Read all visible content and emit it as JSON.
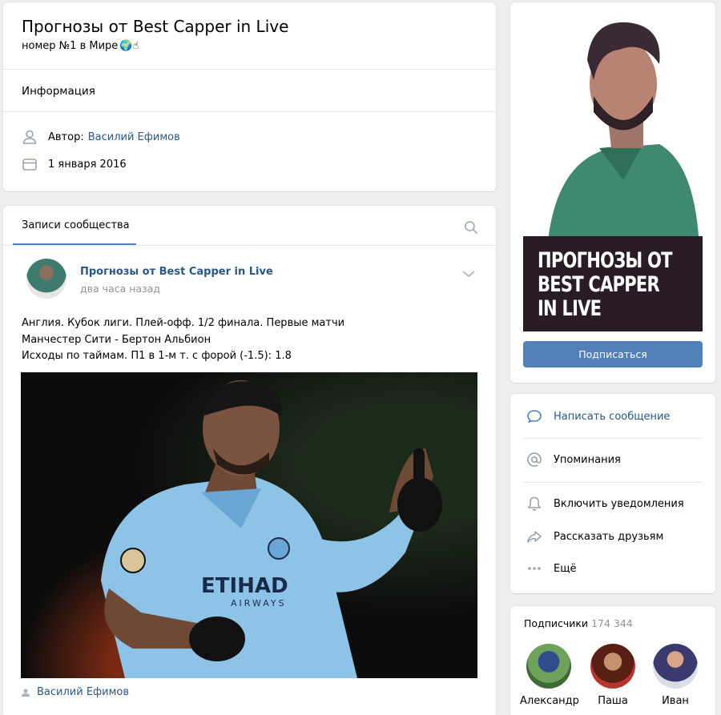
{
  "group": {
    "title": "Прогнозы от Best Capper in Live",
    "status": "номер №1 в Мире",
    "status_emoji": "🌍☝",
    "info_label": "Информация",
    "author_label": "Автор:",
    "author_name": "Василий Ефимов",
    "created_date": "1 января 2016"
  },
  "feed": {
    "tab_label": "Записи сообщества",
    "post": {
      "author": "Прогнозы от Best Capper in Live",
      "time": "два часа назад",
      "lines": [
        "Англия. Кубок лиги. Плей-офф. 1/2 финала. Первые матчи",
        "Манчестер Сити - Бертон Альбион",
        "Исходы по таймам. П1 в 1-м т. с форой (-1.5): 1.8"
      ],
      "photo_sponsor": "ETIHAD AIRWAYS",
      "signer": "Василий Ефимов"
    }
  },
  "cover": {
    "banner_lines": [
      "ПРОГНОЗЫ ОТ",
      "BEST CAPPER",
      "IN LIVE"
    ],
    "subscribe_label": "Подписаться"
  },
  "actions": [
    {
      "label": "Написать сообщение",
      "highlight": true
    },
    {
      "label": "Упоминания",
      "highlight": false
    },
    {
      "label": "Включить уведомления",
      "highlight": false
    },
    {
      "label": "Рассказать друзьям",
      "highlight": false
    },
    {
      "label": "Ещё",
      "highlight": false
    }
  ],
  "subscribers": {
    "label": "Подписчики",
    "count": "174 344",
    "people": [
      {
        "name": "Александр"
      },
      {
        "name": "Паша"
      },
      {
        "name": "Иван"
      }
    ]
  },
  "colors": {
    "accent": "#5181b8",
    "link": "#2a5885",
    "background": "#edeef0"
  }
}
